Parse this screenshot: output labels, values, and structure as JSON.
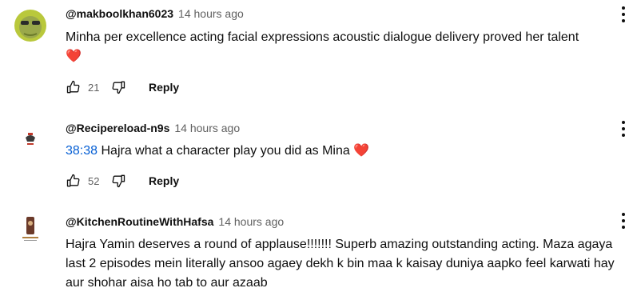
{
  "comments": [
    {
      "author": "@makboolkhan6023",
      "time": "14 hours ago",
      "text": "Minha per excellence acting facial expressions acoustic dialogue delivery proved her talent",
      "heart": "❤️",
      "likes": "21",
      "reply": "Reply"
    },
    {
      "author": "@Recipereload-n9s",
      "time": "14 hours ago",
      "timestamp": "38:38",
      "text": " Hajra what a character play you did as Mina ",
      "heart": "❤️",
      "likes": "52",
      "reply": "Reply"
    },
    {
      "author": "@KitchenRoutineWithHafsa",
      "time": "14 hours ago",
      "text": "Hajra Yamin deserves a round of applause!!!!!!! Superb amazing outstanding acting. Maza agaya last 2 episodes mein literally ansoo agaey dekh k bin maa k kaisay duniya aapko feel karwati hay aur shohar aisa ho tab to aur azaab"
    }
  ],
  "icons": {
    "like": "thumb-up-icon",
    "dislike": "thumb-down-icon",
    "more": "more-vert-icon"
  }
}
